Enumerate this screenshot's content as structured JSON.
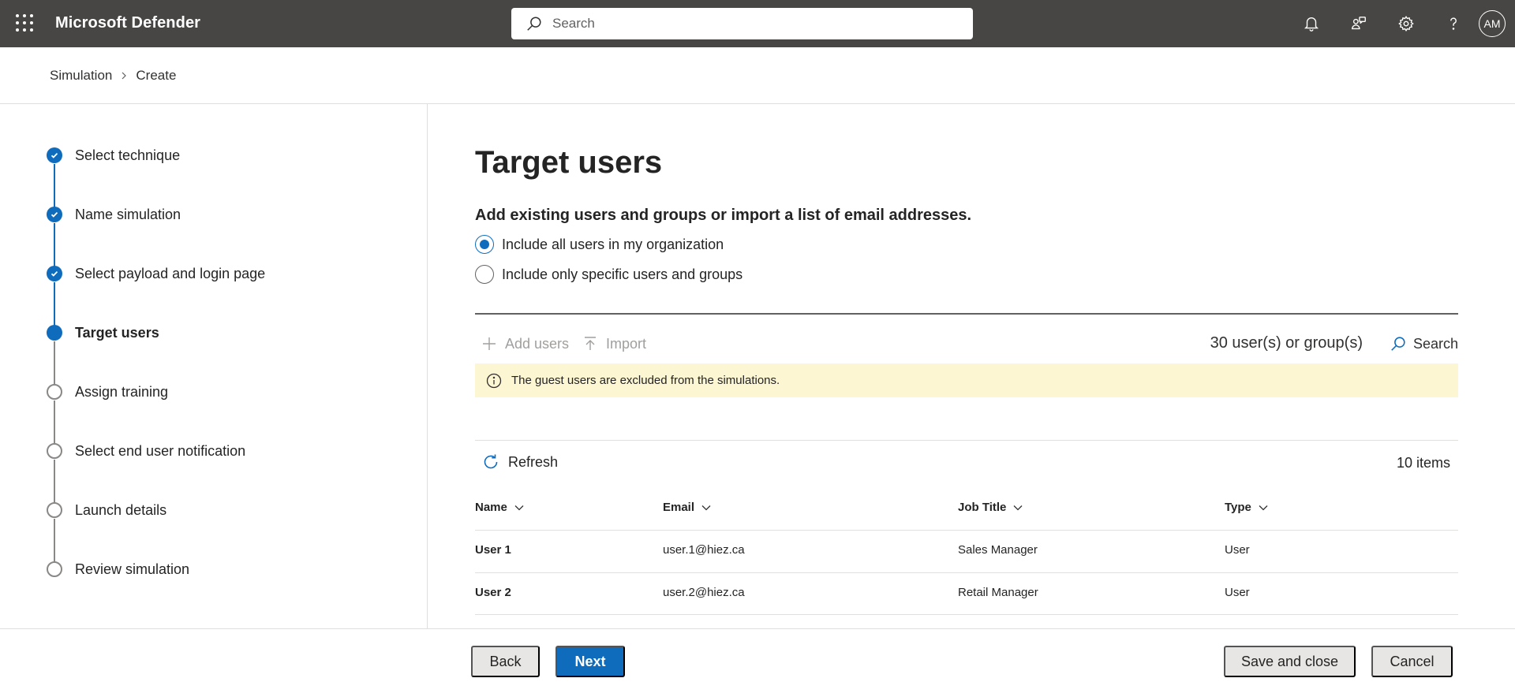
{
  "app": {
    "title": "Microsoft Defender",
    "avatar_initials": "AM"
  },
  "search": {
    "placeholder": "Search"
  },
  "topbar_icons": [
    "bell-icon",
    "people-community-icon",
    "gear-icon",
    "help-icon"
  ],
  "breadcrumb": {
    "items": [
      "Simulation",
      "Create"
    ]
  },
  "steps": [
    {
      "label": "Select technique",
      "state": "done"
    },
    {
      "label": "Name simulation",
      "state": "done"
    },
    {
      "label": "Select payload and login page",
      "state": "done"
    },
    {
      "label": "Target users",
      "state": "current"
    },
    {
      "label": "Assign training",
      "state": "todo"
    },
    {
      "label": "Select end user notification",
      "state": "todo"
    },
    {
      "label": "Launch details",
      "state": "todo"
    },
    {
      "label": "Review simulation",
      "state": "todo"
    }
  ],
  "main": {
    "title": "Target users",
    "description": "Add existing users and groups or import a list of email addresses.",
    "radio_all": "Include all users in my organization",
    "radio_specific": "Include only specific users and groups",
    "selected_option": "all"
  },
  "toolbar": {
    "add_users": "Add users",
    "import": "Import",
    "count": "30 user(s) or group(s)",
    "search": "Search"
  },
  "banner": {
    "text": "The guest users are excluded from the simulations."
  },
  "list": {
    "refresh": "Refresh",
    "items_count": "10 items",
    "columns": [
      "Name",
      "Email",
      "Job Title",
      "Type"
    ],
    "rows": [
      {
        "name": "User 1",
        "email": "user.1@hiez.ca",
        "job_title": "Sales Manager",
        "type": "User"
      },
      {
        "name": "User 2",
        "email": "user.2@hiez.ca",
        "job_title": "Retail Manager",
        "type": "User"
      }
    ]
  },
  "footer": {
    "back": "Back",
    "next": "Next",
    "save_close": "Save and close",
    "cancel": "Cancel"
  },
  "colors": {
    "topbar": "#484644",
    "accent": "#0f6cbd",
    "banner": "#fdf6d3"
  }
}
